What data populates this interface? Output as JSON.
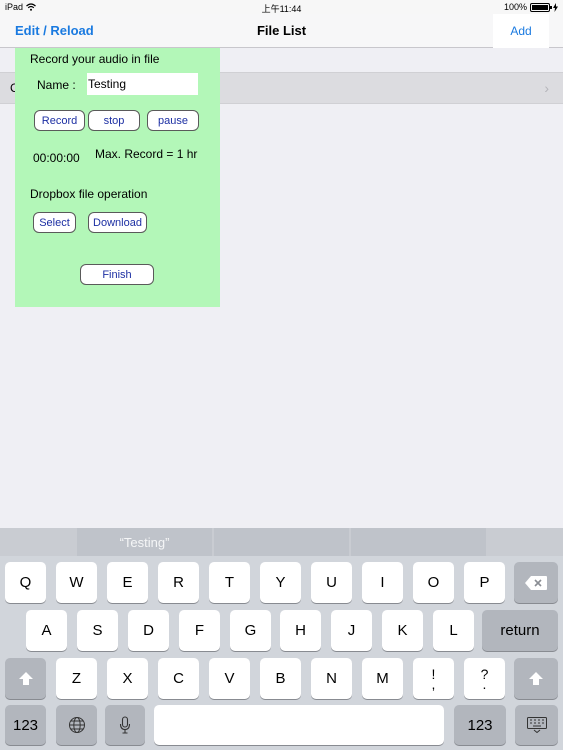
{
  "status_bar": {
    "device": "iPad",
    "time": "上午11:44",
    "battery": "100%",
    "wifi_icon": "wifi-icon",
    "charging_icon": "bolt-icon"
  },
  "navbar": {
    "left_button": "Edit / Reload",
    "title": "File List",
    "add_button": "Add"
  },
  "list": {
    "peek_text": "C",
    "chevron": "›"
  },
  "panel": {
    "heading": "Record your audio in file",
    "name_label": "Name :",
    "name_value": "Testing",
    "record_label": "Record",
    "stop_label": "stop",
    "pause_label": "pause",
    "timer": "00:00:00",
    "max_record": "Max. Record = 1 hr",
    "dropbox_heading": "Dropbox file operation",
    "select_label": "Select",
    "download_label": "Download",
    "finish_label": "Finish"
  },
  "keyboard": {
    "suggestion": "“Testing”",
    "row1": [
      "Q",
      "W",
      "E",
      "R",
      "T",
      "Y",
      "U",
      "I",
      "O",
      "P"
    ],
    "row2": [
      "A",
      "S",
      "D",
      "F",
      "G",
      "H",
      "J",
      "K",
      "L"
    ],
    "row3": [
      "Z",
      "X",
      "C",
      "V",
      "B",
      "N",
      "M"
    ],
    "exclaim_top": "!",
    "exclaim_bottom": ",",
    "question_top": "?",
    "question_bottom": ".",
    "return_label": "return",
    "numbers_left": "123",
    "numbers_right": "123",
    "icons": {
      "delete": "backspace-icon",
      "shift": "shift-icon",
      "globe": "globe-icon",
      "mic": "microphone-icon",
      "hide": "keyboard-hide-icon"
    }
  },
  "colors": {
    "accent": "#1a7ae0",
    "panel_bg": "#b3f7b8",
    "panel_button_text": "#1c2fa3",
    "keyboard_bg": "#d1d5db"
  }
}
